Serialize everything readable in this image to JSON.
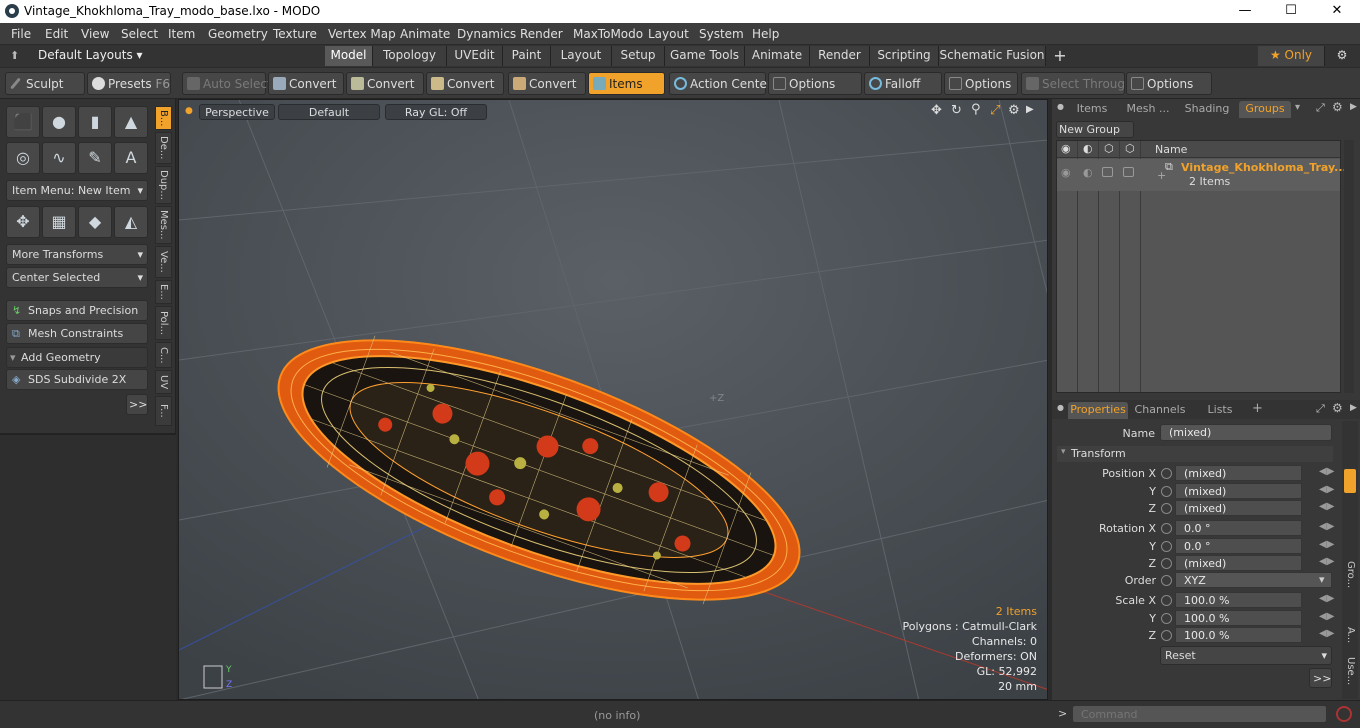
{
  "window": {
    "title": "Vintage_Khokhloma_Tray_modo_base.lxo - MODO",
    "minimize": "—",
    "maximize": "☐",
    "close": "✕"
  },
  "menu": [
    "File",
    "Edit",
    "View",
    "Select",
    "Item",
    "Geometry",
    "Texture",
    "Vertex Map",
    "Animate",
    "Dynamics",
    "Render",
    "MaxToModo",
    "Layout",
    "System",
    "Help"
  ],
  "layouts": {
    "label": "Default Layouts ▾",
    "tabs": [
      "Model",
      "Topology",
      "UVEdit",
      "Paint",
      "Layout",
      "Setup",
      "Game Tools",
      "Animate",
      "Render",
      "Scripting",
      "Schematic Fusion"
    ],
    "active": "Model",
    "add": "+",
    "only": "★  Only"
  },
  "toolbar": {
    "sculpt": "Sculpt",
    "presets": "Presets",
    "presets_key": "F6",
    "auto_select": "Auto Select",
    "convert1": "Convert",
    "convert2": "Convert",
    "convert3": "Convert",
    "convert4": "Convert",
    "items": "Items",
    "action_center": "Action Center",
    "options1": "Options",
    "falloff": "Falloff",
    "options2": "Options",
    "select_through": "Select Through",
    "options3": "Options"
  },
  "left": {
    "item_menu": "Item Menu: New Item",
    "more_transforms": "More Transforms",
    "center_selected": "Center Selected",
    "snaps": "Snaps and Precision",
    "mesh_constraints": "Mesh Constraints",
    "add_geometry": "Add Geometry",
    "sds": "SDS Subdivide 2X",
    "more": ">>",
    "vtabs": [
      "B...",
      "De...",
      "Dup...",
      "Mes...",
      "Ve...",
      "E...",
      "Pol...",
      "C...",
      "UV",
      "F..."
    ]
  },
  "viewport": {
    "perspective": "Perspective",
    "default": "Default",
    "raygl": "Ray GL: Off",
    "axis_label": "+Z",
    "stats": [
      "2 Items",
      "Polygons : Catmull-Clark",
      "Channels: 0",
      "Deformers: ON",
      "GL: 52,992",
      "20 mm"
    ]
  },
  "groups": {
    "tabs": [
      "Items",
      "Mesh ...",
      "Shading",
      "Groups"
    ],
    "active": "Groups",
    "new_group": "New Group",
    "col_name": "Name",
    "group_name": "Vintage_Khokhloma_Tray...",
    "group_count": "2 Items"
  },
  "properties": {
    "tabs": [
      "Properties",
      "Channels",
      "Lists"
    ],
    "add": "+",
    "name_label": "Name",
    "name_value": "(mixed)",
    "transform": "Transform",
    "rows": [
      {
        "label": "Position X",
        "value": "(mixed)"
      },
      {
        "label": "Y",
        "value": "(mixed)"
      },
      {
        "label": "Z",
        "value": "(mixed)"
      },
      {
        "label": "Rotation X",
        "value": "0.0 °"
      },
      {
        "label": "Y",
        "value": "0.0 °"
      },
      {
        "label": "Z",
        "value": "(mixed)"
      },
      {
        "label": "Order",
        "value": "XYZ"
      },
      {
        "label": "Scale X",
        "value": "100.0 %"
      },
      {
        "label": "Y",
        "value": "100.0 %"
      },
      {
        "label": "Z",
        "value": "100.0 %"
      }
    ],
    "reset": "Reset",
    "more": ">>",
    "side_tabs": [
      "Gro...",
      "A...",
      "Use..."
    ]
  },
  "status": {
    "info": "(no info)",
    "command_placeholder": "Command",
    "prompt": ">"
  },
  "colors": {
    "accent": "#f1a22a",
    "wire": "#ff7a00"
  }
}
